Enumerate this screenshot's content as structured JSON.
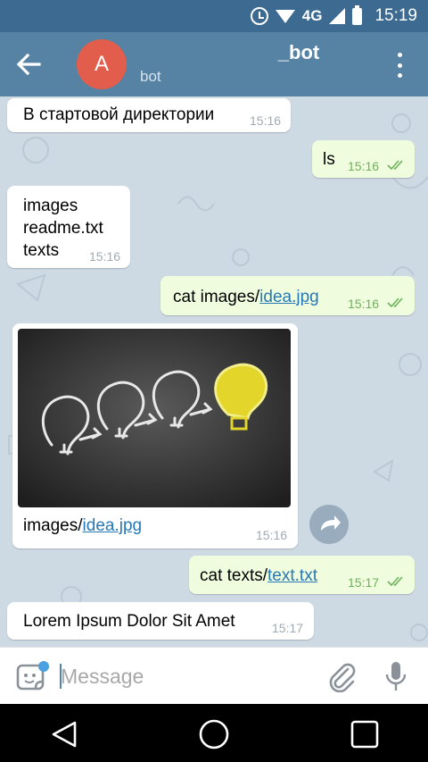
{
  "status_bar": {
    "network": "4G",
    "time": "15:19"
  },
  "header": {
    "avatar_initial": "A",
    "title": "_bot",
    "subtitle": "bot"
  },
  "messages": [
    {
      "direction": "incoming",
      "text": "В стартовой директории",
      "time": "15:16"
    },
    {
      "direction": "outgoing",
      "text": "ls",
      "time": "15:16",
      "status": "read"
    },
    {
      "direction": "incoming",
      "lines": [
        "images",
        "readme.txt",
        "texts"
      ],
      "time": "15:16"
    },
    {
      "direction": "outgoing",
      "prefix": "cat images/",
      "link": "idea.jpg",
      "time": "15:16",
      "status": "read"
    },
    {
      "direction": "incoming",
      "type": "photo",
      "caption_prefix": "images/",
      "caption_link": "idea.jpg",
      "time": "15:16"
    },
    {
      "direction": "outgoing",
      "prefix": "cat texts/",
      "link": "text.txt",
      "time": "15:17",
      "status": "read"
    },
    {
      "direction": "incoming",
      "text": "Lorem Ipsum Dolor Sit Amet",
      "time": "15:17"
    }
  ],
  "input": {
    "placeholder": "Message"
  },
  "colors": {
    "header": "#5682a3",
    "status_bar": "#3d6a90",
    "avatar": "#e25d4c",
    "outgoing_bubble": "#effdde",
    "link": "#2678b6",
    "read_checks": "#70b15c"
  }
}
